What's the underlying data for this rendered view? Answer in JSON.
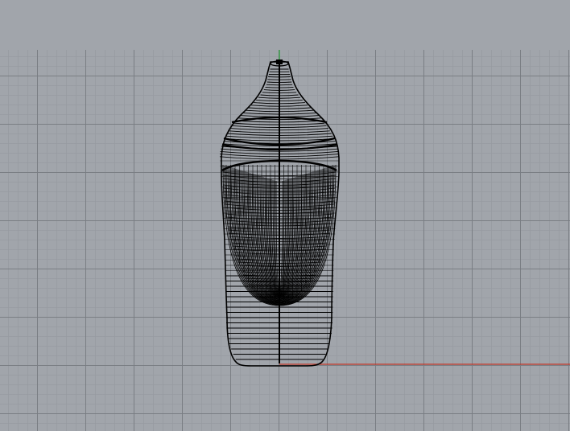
{
  "viewport": {
    "background_color": "#a1a5ab",
    "grid_major_color": "#787c82",
    "grid_minor_color": "#969aa0"
  },
  "axes": {
    "x_axis_color": "#c0392b",
    "y_axis_color": "#2e9e3e"
  },
  "model": {
    "object": "bottle-wireframe",
    "wire_color": "#000000"
  }
}
